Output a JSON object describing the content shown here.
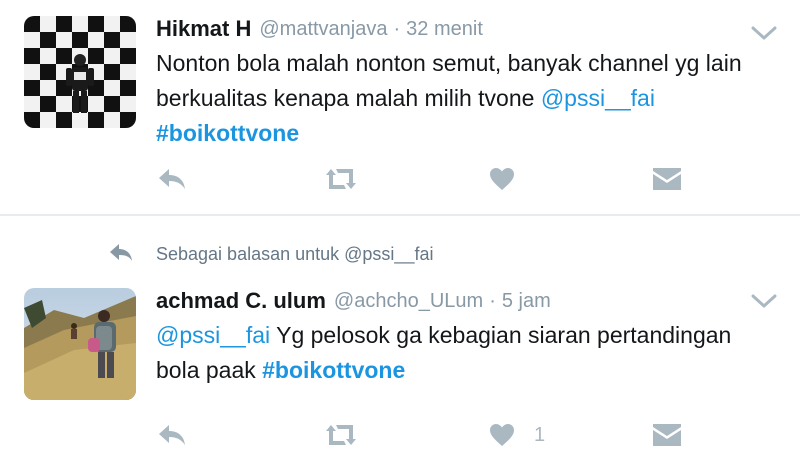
{
  "tweets": [
    {
      "author": "Hikmat H",
      "handle": "@mattvanjava",
      "separator": "·",
      "time": "32 menit",
      "text_part1": "Nonton bola malah nonton semut, banyak channel yg lain berkualitas kenapa malah milih tvone ",
      "mention": "@pssi__fai",
      "hashtag": "#boikottvone",
      "like_count": ""
    },
    {
      "reply_context": "Sebagai balasan untuk @pssi__fai",
      "author": "achmad C. ulum",
      "handle": "@achcho_ULum",
      "separator": "·",
      "time": "5 jam",
      "mention": "@pssi__fai",
      "text_part1": " Yg pelosok ga kebagian siaran pertandingan bola paak ",
      "hashtag": "#boikottvone",
      "like_count": "1"
    }
  ],
  "icons": {
    "reply": "reply-icon",
    "retweet": "retweet-icon",
    "like": "heart-icon",
    "dm": "envelope-icon",
    "more": "chevron-down-icon"
  },
  "colors": {
    "link": "#1b95e0",
    "secondary_text": "#8899a6",
    "action_icon": "#aab8c2",
    "divider": "#e6ecf0"
  }
}
